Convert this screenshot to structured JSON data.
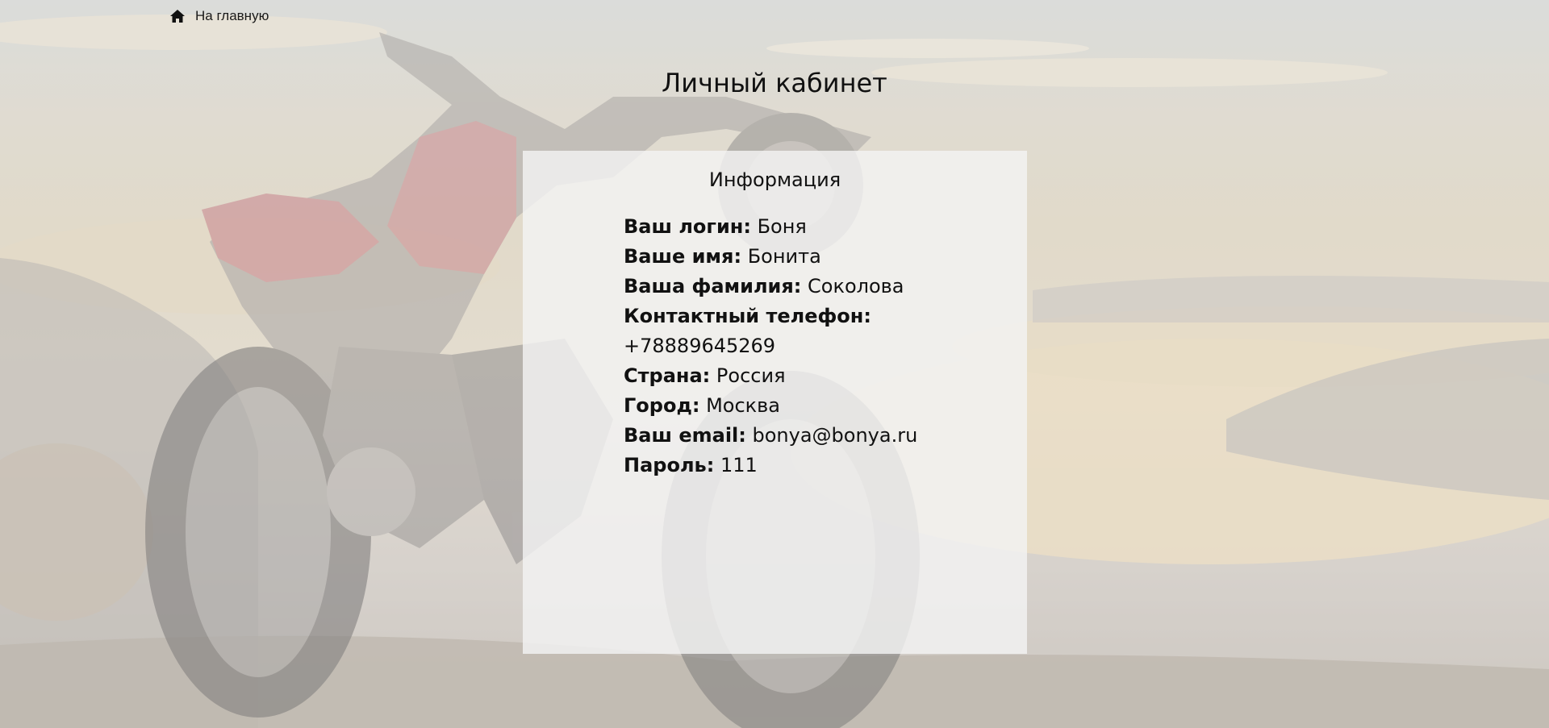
{
  "nav": {
    "home_label": "На главную",
    "home_icon": "home-icon"
  },
  "page": {
    "title": "Личный кабинет",
    "background": "motorcycle-sunset-photo"
  },
  "card": {
    "title": "Информация",
    "fields": [
      {
        "label": "Ваш логин:",
        "value": "Боня"
      },
      {
        "label": "Ваше имя:",
        "value": "Бонита"
      },
      {
        "label": "Ваша фамилия:",
        "value": "Соколова"
      },
      {
        "label": "Контактный телефон:",
        "value": "+78889645269"
      },
      {
        "label": "Страна:",
        "value": "Россия"
      },
      {
        "label": "Город:",
        "value": "Москва"
      },
      {
        "label": "Ваш email:",
        "value": "bonya@bonya.ru"
      },
      {
        "label": "Пароль:",
        "value": "111"
      }
    ]
  },
  "colors": {
    "text": "#111111",
    "card_bg": "#f3f3f3",
    "sky": "#d9cfb8"
  }
}
